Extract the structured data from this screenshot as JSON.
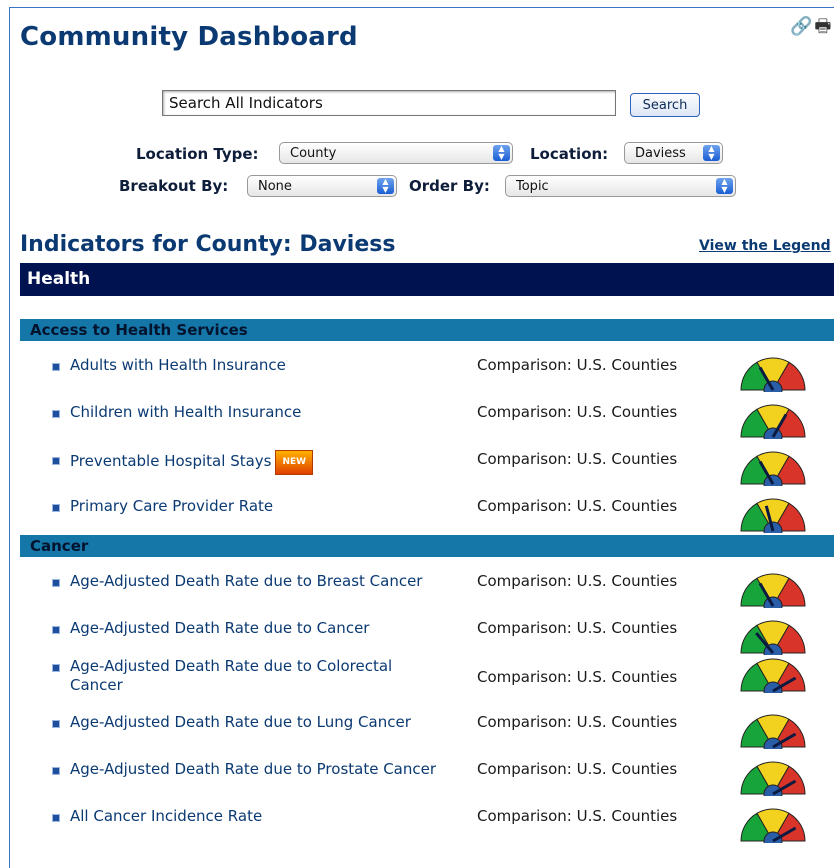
{
  "header": {
    "title": "Community Dashboard"
  },
  "search": {
    "value": "Search All Indicators",
    "button_label": "Search"
  },
  "filters": {
    "location_type_label": "Location Type:",
    "location_type_value": "County",
    "location_label": "Location:",
    "location_value": "Daviess",
    "breakout_label": "Breakout By:",
    "breakout_value": "None",
    "order_label": "Order By:",
    "order_value": "Topic"
  },
  "indicators": {
    "title": "Indicators for County: Daviess",
    "legend_link": "View the Legend",
    "section": "Health",
    "groups": [
      {
        "name": "Access to Health Services",
        "rows": [
          {
            "label": "Adults with Health Insurance",
            "comparison": "Comparison: U.S. Counties",
            "badge": ""
          },
          {
            "label": "Children with Health Insurance",
            "comparison": "Comparison: U.S. Counties",
            "badge": ""
          },
          {
            "label": "Preventable Hospital Stays",
            "comparison": "Comparison: U.S. Counties",
            "badge": "NEW"
          },
          {
            "label": "Primary Care Provider Rate",
            "comparison": "Comparison: U.S. Counties",
            "badge": ""
          }
        ]
      },
      {
        "name": "Cancer",
        "rows": [
          {
            "label": "Age-Adjusted Death Rate due to Breast Cancer",
            "comparison": "Comparison: U.S. Counties",
            "badge": ""
          },
          {
            "label": "Age-Adjusted Death Rate due to Cancer",
            "comparison": "Comparison: U.S. Counties",
            "badge": ""
          },
          {
            "label": "Age-Adjusted Death Rate due to Colorectal Cancer",
            "comparison": "Comparison: U.S. Counties",
            "badge": ""
          },
          {
            "label": "Age-Adjusted Death Rate due to Lung Cancer",
            "comparison": "Comparison: U.S. Counties",
            "badge": ""
          },
          {
            "label": "Age-Adjusted Death Rate due to Prostate Cancer",
            "comparison": "Comparison: U.S. Counties",
            "badge": ""
          },
          {
            "label": "All Cancer Incidence Rate",
            "comparison": "Comparison: U.S. Counties",
            "badge": ""
          }
        ]
      }
    ]
  },
  "colors": {
    "navy": "#00124f",
    "group_bar": "#1577a8",
    "gauge_green": "#17a43a",
    "gauge_yellow": "#f2d21f",
    "gauge_red": "#d8342a"
  }
}
